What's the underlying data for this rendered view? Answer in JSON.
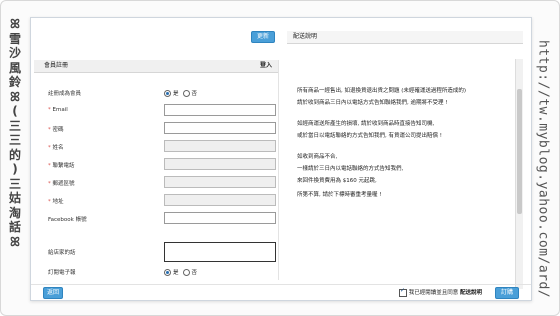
{
  "decor": {
    "left_chars": [
      "ꕤ",
      "雪",
      "沙",
      "風",
      "鈴",
      "ꕤ",
      "(",
      "三",
      "三",
      "的",
      ")",
      "三",
      "姑",
      "淘",
      "話",
      "ꕤ"
    ],
    "right_text": "http://tw.myblog.yahoo.com/ard/"
  },
  "toolbar": {
    "refresh_label": "更新"
  },
  "form": {
    "title": "會員註冊",
    "login_link": "登入",
    "member_label": "註冊成為會員",
    "member_yes": "是",
    "member_no": "否",
    "fields": [
      {
        "label": "Email",
        "required": true
      },
      {
        "label": "密碼",
        "required": true
      },
      {
        "label": "姓名",
        "required": true
      },
      {
        "label": "聯繫電話",
        "required": true
      },
      {
        "label": "郵遞區號",
        "required": true
      },
      {
        "label": "地址",
        "required": true
      },
      {
        "label": "Facebook 帳號",
        "required": false
      }
    ],
    "store_note_label": "給店家的話",
    "subscribe_label": "訂閱電子報",
    "subscribe_yes": "是",
    "subscribe_no": "否"
  },
  "shipping": {
    "title": "配送說明",
    "lines": [
      "所有商品一經售出, 如退換貨退出貨之問題 (未經確運送過程所造成的)",
      "請於收到商品三日內以電話方式告知聯絡我們, 逾期將不受理 !",
      "如經商運送所產生的損壞, 請於收到商品時直接告知司機,",
      "或於當日以電話聯絡的方式告知我們, 有貨運公司提出賠償 !",
      "如收到商品不合,",
      "一樣請於三日內以電話聯絡的方式告知我們,",
      "來回件換貨費用為 $160 元起跳,",
      "所第不算, 請於下標時審重考量喔 !"
    ]
  },
  "footer": {
    "back_label": "返回",
    "agree_label": "我已經閱讀並且同意",
    "agree_link": "配送說明",
    "order_label": "訂購"
  },
  "colors": {
    "accent": "#4a9fd8",
    "required": "#d9534f"
  }
}
